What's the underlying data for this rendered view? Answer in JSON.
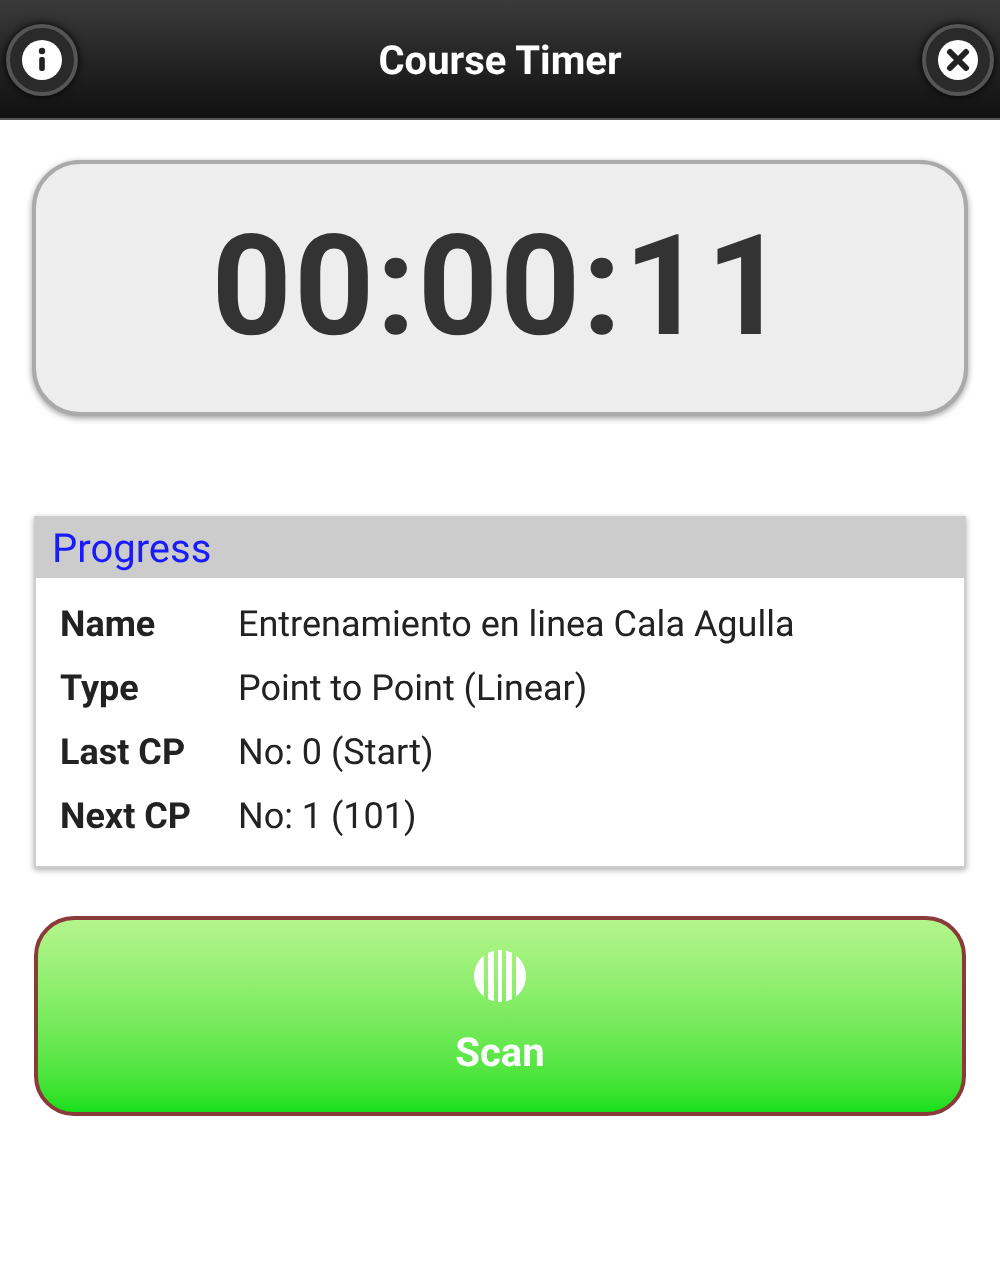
{
  "header": {
    "title": "Course Timer"
  },
  "timer": {
    "display": "00:00:11"
  },
  "progress": {
    "title": "Progress",
    "rows": [
      {
        "label": "Name",
        "value": "Entrenamiento en linea Cala Agulla"
      },
      {
        "label": "Type",
        "value": "Point to Point (Linear)"
      },
      {
        "label": "Last CP",
        "value": "No: 0 (Start)"
      },
      {
        "label": "Next CP",
        "value": "No: 1 (101)"
      }
    ]
  },
  "scan_button": {
    "label": "Scan"
  }
}
